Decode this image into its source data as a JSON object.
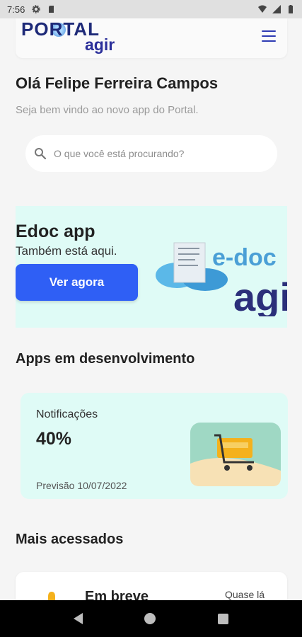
{
  "status_bar": {
    "time": "7:56"
  },
  "header": {
    "logo_word": "PORTAL",
    "logo_sub": "agir"
  },
  "greeting": {
    "title": "Olá Felipe Ferreira Campos",
    "subtitle": "Seja bem vindo ao novo app do Portal."
  },
  "search": {
    "placeholder": "O que você está procurando?"
  },
  "banner": {
    "title": "Edoc app",
    "subtitle": "Também está aqui.",
    "button": "Ver agora",
    "art_text": "e-doc",
    "art_sub": "agir"
  },
  "dev_section": {
    "title": "Apps em desenvolvimento",
    "card": {
      "name": "Notificações",
      "progress": "40%",
      "forecast": "Previsão 10/07/2022"
    }
  },
  "access_section": {
    "title": "Mais acessados",
    "card": {
      "title": "Em breve",
      "tag": "Quase lá"
    }
  }
}
